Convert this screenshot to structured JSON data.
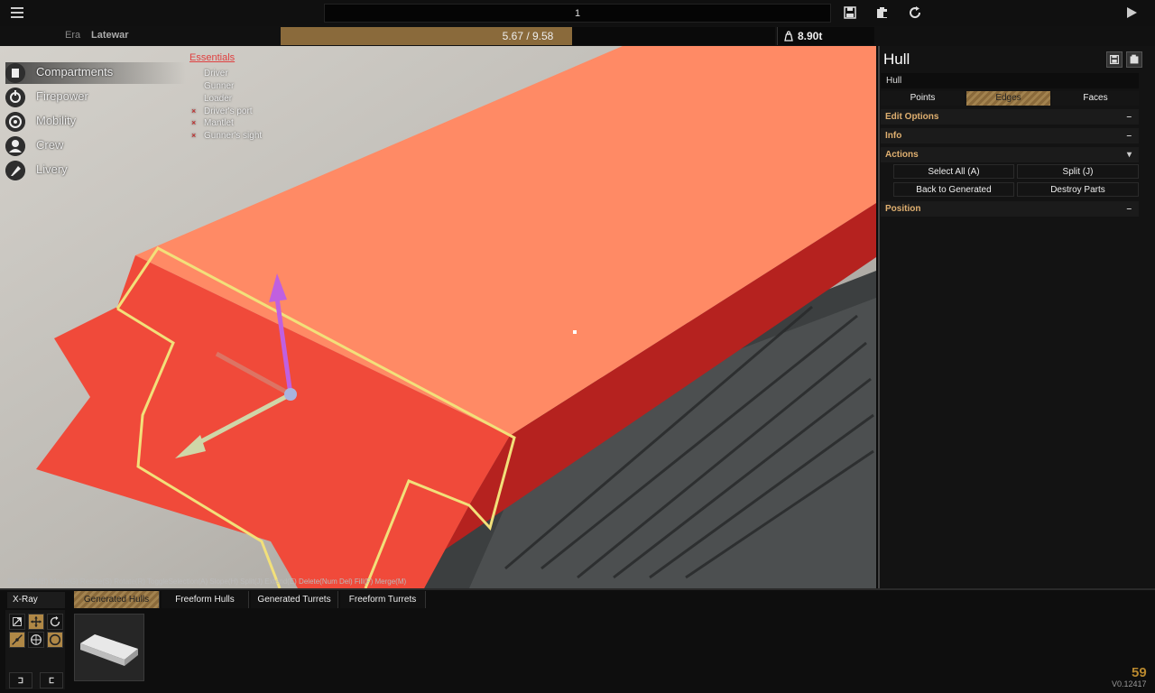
{
  "topbar": {
    "name_value": "1",
    "icons": [
      "menu-icon",
      "save-icon",
      "paste-icon",
      "refresh-icon",
      "play-icon"
    ]
  },
  "era": {
    "label": "Era",
    "value": "Latewar"
  },
  "points": {
    "text": "5.67 / 9.58",
    "fraction": 0.59
  },
  "weight": {
    "text": "8.90t"
  },
  "nav": {
    "items": [
      {
        "label": "Compartments",
        "icon": "compartment-icon"
      },
      {
        "label": "Firepower",
        "icon": "firepower-icon"
      },
      {
        "label": "Mobility",
        "icon": "mobility-icon"
      },
      {
        "label": "Crew",
        "icon": "crew-icon"
      },
      {
        "label": "Livery",
        "icon": "livery-icon"
      }
    ]
  },
  "essentials": {
    "title": "Essentials",
    "items": [
      {
        "label": "Driver",
        "status": "ok"
      },
      {
        "label": "Gunner",
        "status": "ok"
      },
      {
        "label": "Loader",
        "status": "ok"
      },
      {
        "label": "Driver's port",
        "status": "missing"
      },
      {
        "label": "Mantlet",
        "status": "missing"
      },
      {
        "label": "Gunner's sight",
        "status": "missing"
      }
    ],
    "missing_mark": "×"
  },
  "shortcuts": "Select(RMB) Move(G) Resize(S) Rotate(R) ToggleSelection(A) Slope(H) Split(J) Extend(E) Delete(Num Del) Fill(F) Merge(M)",
  "panel": {
    "title": "Hull",
    "field_value": "Hull",
    "modes": [
      "Points",
      "Edges",
      "Faces"
    ],
    "active_mode": "Edges",
    "sections": {
      "edit_options": {
        "label": "Edit Options",
        "toggle": "–"
      },
      "info": {
        "label": "Info",
        "toggle": "–"
      },
      "actions": {
        "label": "Actions",
        "toggle": "▾"
      },
      "position": {
        "label": "Position",
        "toggle": "–"
      }
    },
    "actions": {
      "select_all": "Select All (A)",
      "split": "Split (J)",
      "back_to_generated": "Back to Generated",
      "destroy_parts": "Destroy Parts"
    }
  },
  "bottom": {
    "xray": "X-Ray",
    "tabs": [
      "Generated Hulls",
      "Freeform Hulls",
      "Generated Turrets",
      "Freeform Turrets"
    ],
    "active_tab": "Generated Hulls",
    "fps": "59",
    "version": "V0.12417"
  },
  "colors": {
    "accent": "#8a6a3b",
    "hull_top": "#ff8a65",
    "hull_side": "#f04a3a",
    "selection": "#f2e07a",
    "section_header": "#e0b070"
  }
}
